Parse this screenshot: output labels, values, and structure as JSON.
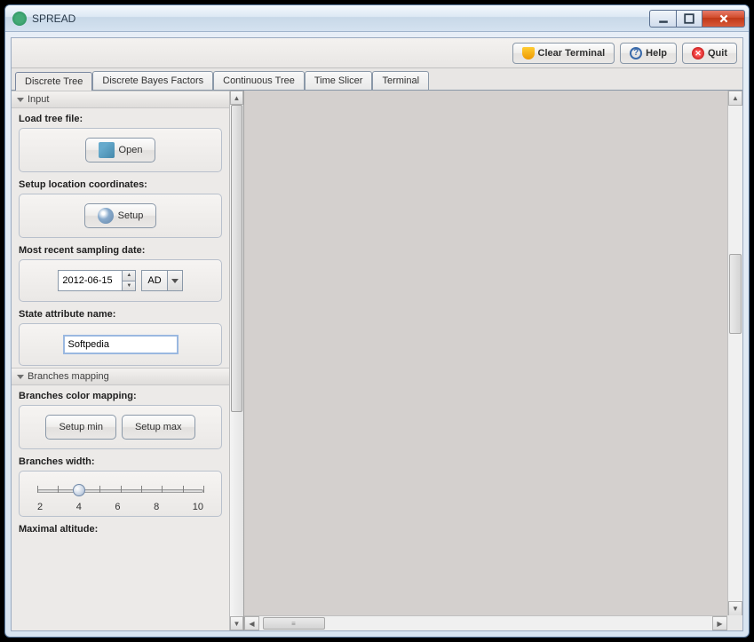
{
  "window": {
    "title": "SPREAD"
  },
  "toolbar": {
    "clear": "Clear Terminal",
    "help": "Help",
    "quit": "Quit"
  },
  "tabs": [
    {
      "label": "Discrete Tree",
      "active": true
    },
    {
      "label": "Discrete Bayes Factors",
      "active": false
    },
    {
      "label": "Continuous Tree",
      "active": false
    },
    {
      "label": "Time Slicer",
      "active": false
    },
    {
      "label": "Terminal",
      "active": false
    }
  ],
  "sections": {
    "input": {
      "title": "Input"
    },
    "branches": {
      "title": "Branches mapping"
    }
  },
  "fields": {
    "loadTree": {
      "label": "Load tree file:",
      "button": "Open"
    },
    "setupLocation": {
      "label": "Setup location coordinates:",
      "button": "Setup"
    },
    "samplingDate": {
      "label": "Most recent sampling date:",
      "value": "2012-06-15",
      "era": "AD"
    },
    "stateAttr": {
      "label": "State attribute name:",
      "value": "Softpedia"
    },
    "branchesColor": {
      "label": "Branches color mapping:",
      "min": "Setup min",
      "max": "Setup max"
    },
    "branchesWidth": {
      "label": "Branches width:",
      "ticks": [
        "2",
        "4",
        "6",
        "8",
        "10"
      ],
      "value": 4,
      "min": 2,
      "max": 10
    },
    "maxAltitude": {
      "label": "Maximal altitude:"
    }
  }
}
